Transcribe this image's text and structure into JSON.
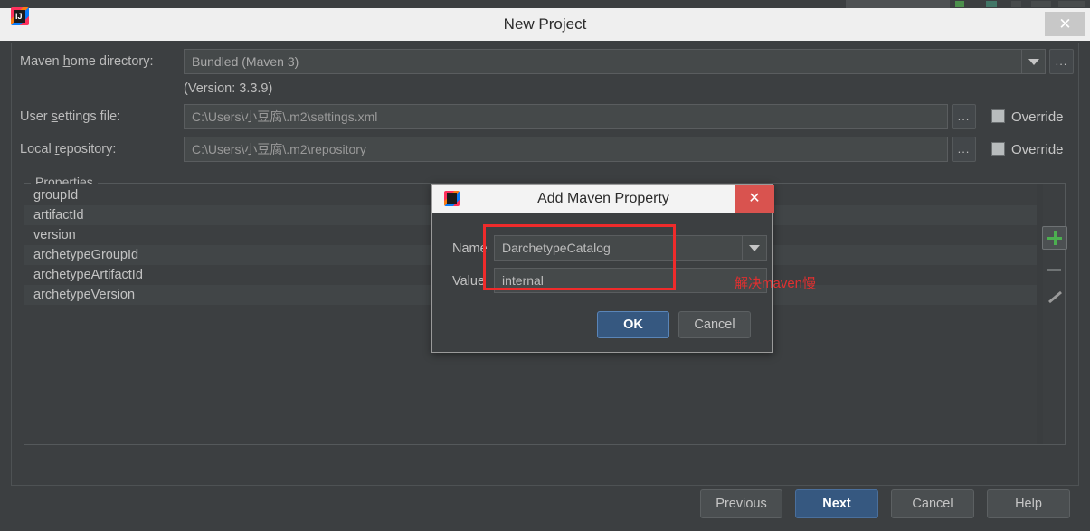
{
  "window": {
    "title": "New Project",
    "icon": "intellij-idea-icon",
    "close_label": "✕"
  },
  "form": {
    "maven_home": {
      "label_pre": "Maven ",
      "label_accel": "h",
      "label_post": "ome directory:",
      "value": "Bundled (Maven 3)",
      "ellipsis": "...",
      "version_note": "(Version: 3.3.9)"
    },
    "user_settings": {
      "label_pre": "User ",
      "label_accel": "s",
      "label_post": "ettings file:",
      "value": "C:\\Users\\小豆腐\\.m2\\settings.xml",
      "ellipsis": "...",
      "override_label": "Override"
    },
    "local_repository": {
      "label_pre": "Local ",
      "label_accel": "r",
      "label_post": "epository:",
      "value": "C:\\Users\\小豆腐\\.m2\\repository",
      "ellipsis": "...",
      "override_label": "Override"
    }
  },
  "properties": {
    "legend": "Properties",
    "items": [
      "groupId",
      "artifactId",
      "version",
      "archetypeGroupId",
      "archetypeArtifactId",
      "archetypeVersion"
    ],
    "tools": {
      "add": "add-property",
      "remove": "remove-property",
      "edit": "edit-property"
    }
  },
  "footer": {
    "previous": "Previous",
    "next": "Next",
    "cancel": "Cancel",
    "help": "Help"
  },
  "modal": {
    "title": "Add Maven Property",
    "icon": "intellij-idea-icon",
    "close_label": "✕",
    "name_label": "Name",
    "name_value": "DarchetypeCatalog",
    "value_label": "Value",
    "value_value": "internal",
    "ok": "OK",
    "cancel": "Cancel"
  },
  "annotations": {
    "note": "解决maven慢",
    "accent_color": "#ef2b2b"
  }
}
